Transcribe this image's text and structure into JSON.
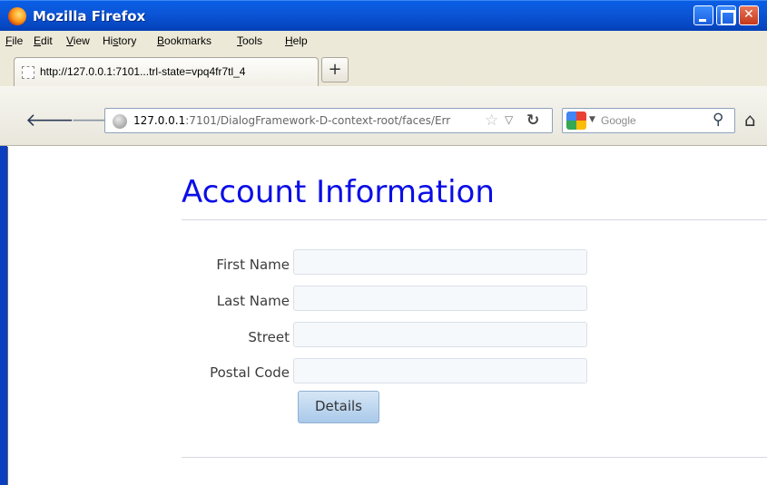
{
  "window": {
    "title": "Mozilla Firefox"
  },
  "menubar": {
    "items": [
      {
        "accel": "F",
        "rest": "ile"
      },
      {
        "accel": "E",
        "rest": "dit"
      },
      {
        "accel": "V",
        "rest": "iew"
      },
      {
        "pre": "Hi",
        "accel": "s",
        "rest": "tory"
      },
      {
        "accel": "B",
        "rest": "ookmarks"
      },
      {
        "accel": "T",
        "rest": "ools"
      },
      {
        "accel": "H",
        "rest": "elp"
      }
    ]
  },
  "tabs": [
    {
      "label": "http://127.0.0.1:7101...trl-state=vpq4fr7tl_4"
    }
  ],
  "new_tab_label": "+",
  "address_bar": {
    "host": "127.0.0.1",
    "rest": ":7101/DialogFramework-D-context-root/faces/Err"
  },
  "search": {
    "placeholder": "Google"
  },
  "page": {
    "title": "Account Information",
    "fields": [
      {
        "label": "First Name",
        "value": ""
      },
      {
        "label": "Last Name",
        "value": ""
      },
      {
        "label": "Street",
        "value": ""
      },
      {
        "label": "Postal Code",
        "value": ""
      }
    ],
    "details_button": "Details"
  },
  "colors": {
    "title_blue": "#0b0ee6",
    "titlebar_blue": "#0b56d8",
    "button_blue": "#a9c9ea"
  }
}
